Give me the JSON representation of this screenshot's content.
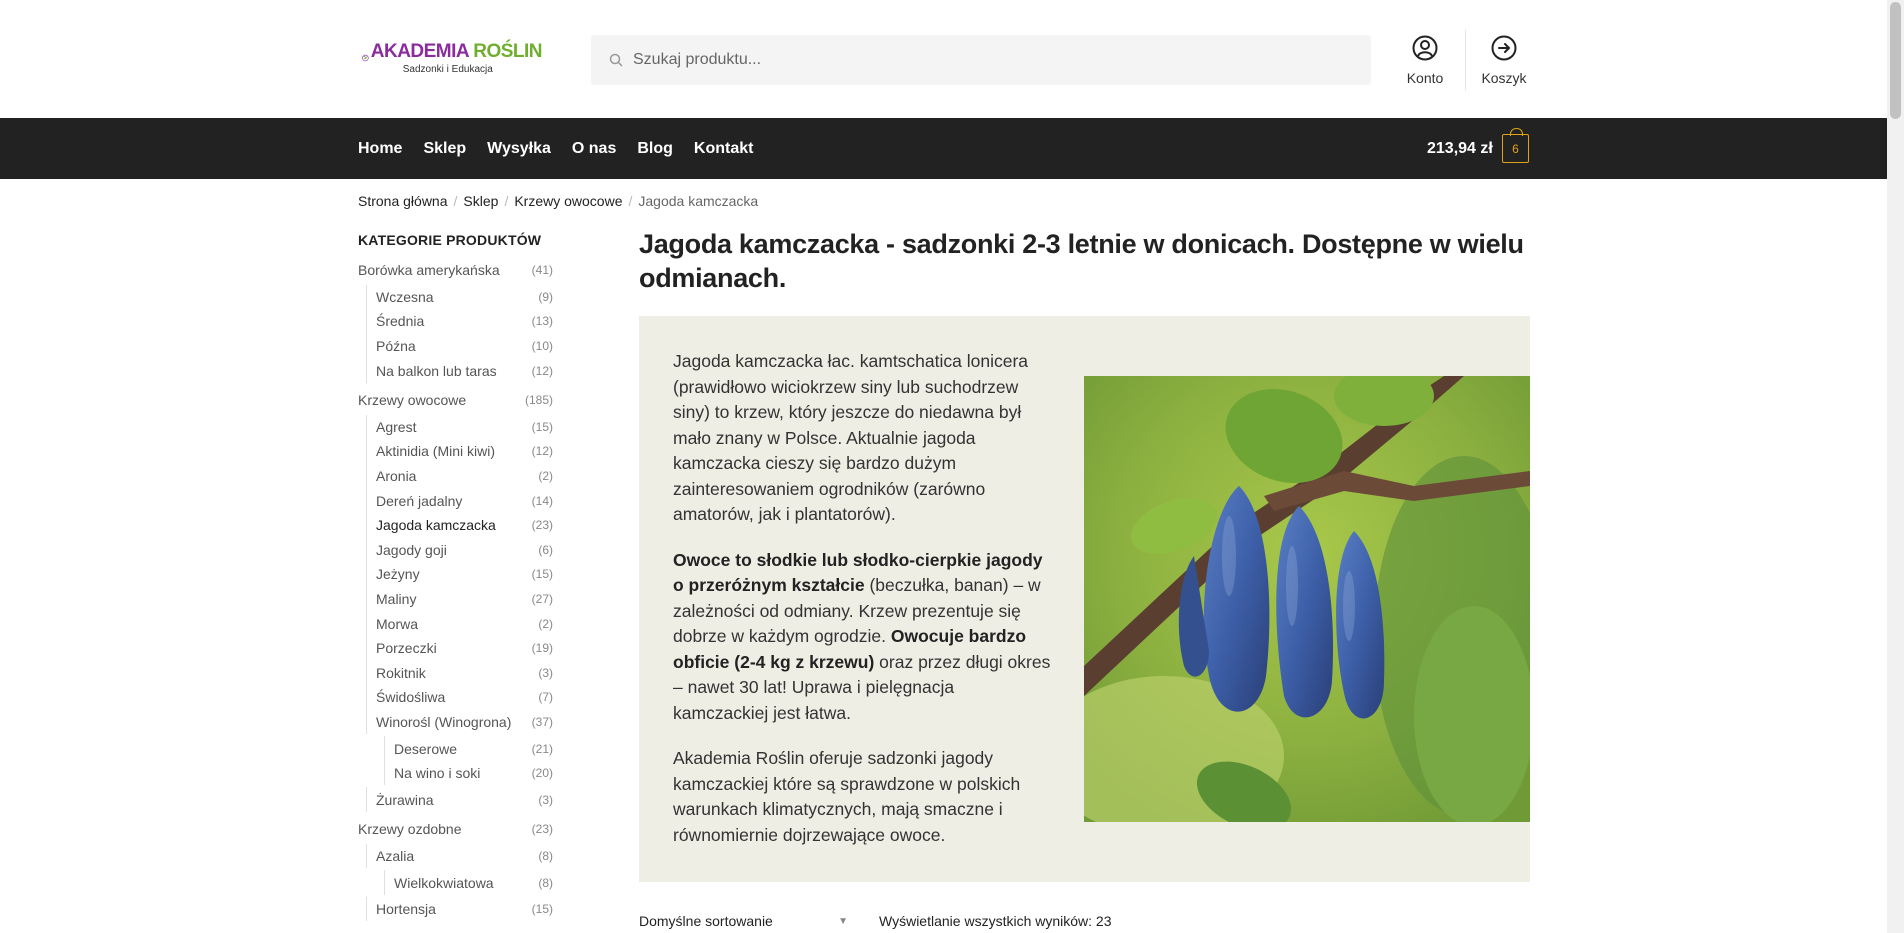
{
  "header": {
    "logo_title_part1": "AKADEMIA",
    "logo_title_part2": "ROŚLIN",
    "logo_subtitle": "Sadzonki i Edukacja",
    "search_placeholder": "Szukaj produktu...",
    "account_label": "Konto",
    "cart_label": "Koszyk"
  },
  "nav": {
    "items": [
      "Home",
      "Sklep",
      "Wysyłka",
      "O nas",
      "Blog",
      "Kontakt"
    ],
    "cart_total": "213,94 zł",
    "cart_count": "6",
    "accent_color": "#e0a21a"
  },
  "breadcrumb": [
    "Strona główna",
    "Sklep",
    "Krzewy owocowe",
    "Jagoda kamczacka"
  ],
  "sidebar": {
    "title": "KATEGORIE PRODUKTÓW",
    "items": [
      {
        "name": "Borówka amerykańska",
        "count": "(41)"
      },
      {
        "name": "Wczesna",
        "count": "(9)"
      },
      {
        "name": "Średnia",
        "count": "(13)"
      },
      {
        "name": "Późna",
        "count": "(10)"
      },
      {
        "name": "Na balkon lub taras",
        "count": "(12)"
      },
      {
        "name": "Krzewy owocowe",
        "count": "(185)"
      },
      {
        "name": "Agrest",
        "count": "(15)"
      },
      {
        "name": "Aktinidia (Mini kiwi)",
        "count": "(12)"
      },
      {
        "name": "Aronia",
        "count": "(2)"
      },
      {
        "name": "Dereń jadalny",
        "count": "(14)"
      },
      {
        "name": "Jagoda kamczacka",
        "count": "(23)"
      },
      {
        "name": "Jagody goji",
        "count": "(6)"
      },
      {
        "name": "Jeżyny",
        "count": "(15)"
      },
      {
        "name": "Maliny",
        "count": "(27)"
      },
      {
        "name": "Morwa",
        "count": "(2)"
      },
      {
        "name": "Porzeczki",
        "count": "(19)"
      },
      {
        "name": "Rokitnik",
        "count": "(3)"
      },
      {
        "name": "Świdośliwa",
        "count": "(7)"
      },
      {
        "name": "Winorośl (Winogrona)",
        "count": "(37)"
      },
      {
        "name": "Deserowe",
        "count": "(21)"
      },
      {
        "name": "Na wino i soki",
        "count": "(20)"
      },
      {
        "name": "Żurawina",
        "count": "(3)"
      },
      {
        "name": "Krzewy ozdobne",
        "count": "(23)"
      },
      {
        "name": "Azalia",
        "count": "(8)"
      },
      {
        "name": "Wielkokwiatowa",
        "count": "(8)"
      },
      {
        "name": "Hortensja",
        "count": "(15)"
      }
    ]
  },
  "main": {
    "title": "Jagoda kamczacka - sadzonki 2-3 letnie w donicach. Dostępne w wielu odmianach.",
    "p1": "Jagoda kamczacka łac. kamtschatica lonicera (prawidłowo wiciokrzew siny lub suchodrzew siny) to krzew, który jeszcze do niedawna był mało znany w Polsce. Aktualnie jagoda kamczacka cieszy się bardzo dużym zainteresowaniem ogrodników (zarówno amatorów, jak i plantatorów).",
    "p2_bold1": "Owoce to słodkie lub słodko-cierpkie jagody o przeróżnym kształcie",
    "p2_text1": " (beczułka, banan) – w zależności od odmiany. Krzew prezentuje się dobrze w każdym ogrodzie. ",
    "p2_bold2": "Owocuje bardzo obficie (2-4 kg z krzewu)",
    "p2_text2": " oraz przez długi okres – nawet 30 lat! Uprawa i pielęgnacja kamczackiej jest łatwa.",
    "p3": "Akademia Roślin oferuje sadzonki jagody kamczackiej które są sprawdzone w polskich warunkach klimatycznych, mają smaczne i równomiernie dojrzewające owoce.",
    "sort_label": "Domyślne sortowanie",
    "result_count": "Wyświetlanie wszystkich wyników: 23"
  }
}
